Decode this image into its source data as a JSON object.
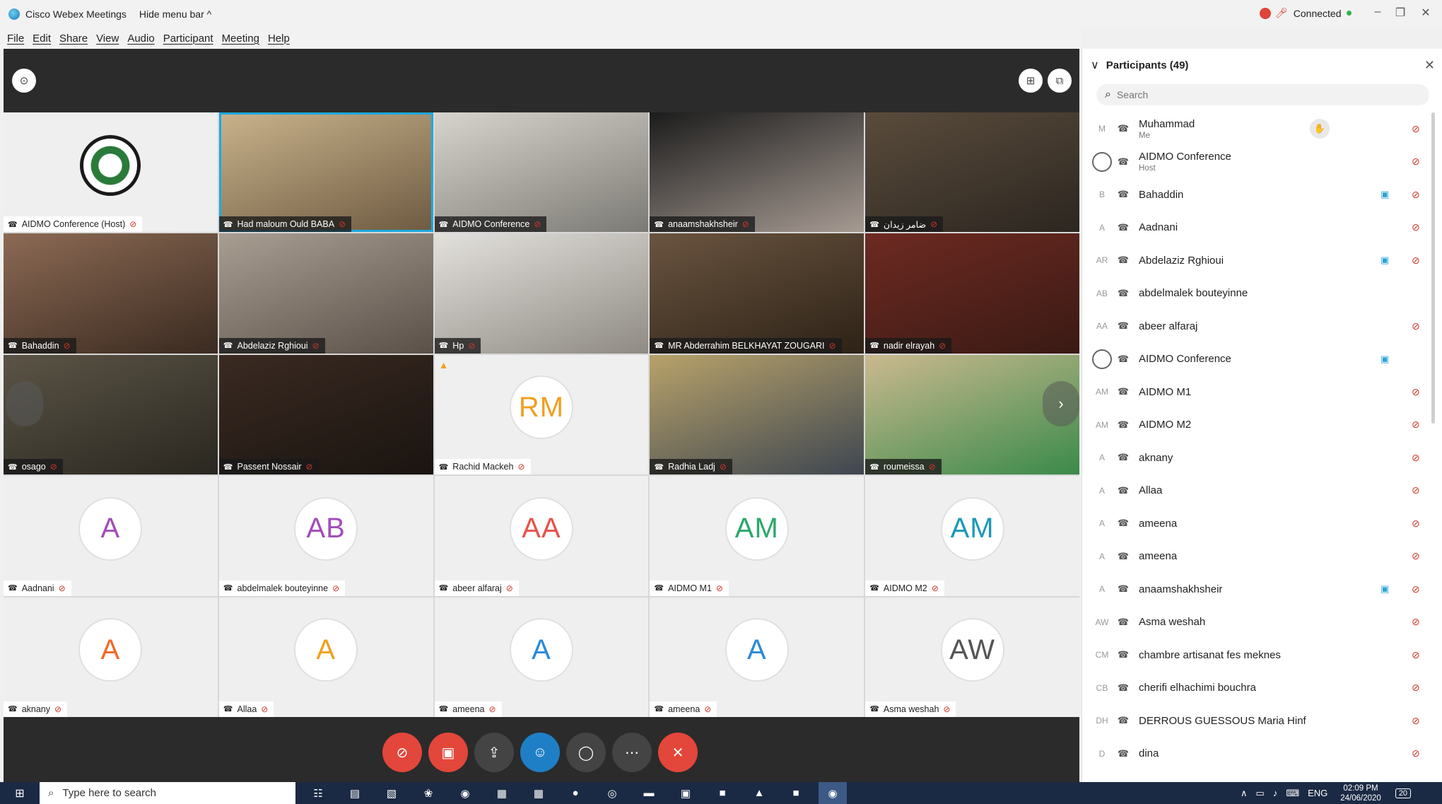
{
  "titlebar": {
    "app_title": "Cisco Webex Meetings",
    "hide_menu": "Hide menu bar ^",
    "status": "Connected",
    "win_min": "–",
    "win_restore": "❐",
    "win_close": "✕"
  },
  "menu": [
    "File",
    "Edit",
    "Share",
    "View",
    "Audio",
    "Participant",
    "Meeting",
    "Help"
  ],
  "tiles": [
    {
      "name": "AIDMO Conference (Host)",
      "type": "logo"
    },
    {
      "name": "Had maloum Ould BABA",
      "type": "video",
      "selected": true
    },
    {
      "name": "AIDMO Conference",
      "type": "video"
    },
    {
      "name": "anaamshakhsheir",
      "type": "video"
    },
    {
      "name": "ضامر زيدان",
      "type": "video"
    },
    {
      "name": "Bahaddin",
      "type": "video"
    },
    {
      "name": "Abdelaziz Rghioui",
      "type": "video"
    },
    {
      "name": "Hp",
      "type": "video"
    },
    {
      "name": "MR Abderrahim BELKHAYAT ZOUGARI",
      "type": "video"
    },
    {
      "name": "nadir elrayah",
      "type": "video"
    },
    {
      "name": "osago",
      "type": "video"
    },
    {
      "name": "Passent Nossair",
      "type": "video"
    },
    {
      "name": "Rachid Mackeh",
      "type": "avatar",
      "initials": "RM",
      "color": "#f0a020"
    },
    {
      "name": "Radhia Ladj",
      "type": "video"
    },
    {
      "name": "roumeissa",
      "type": "video"
    },
    {
      "name": "Aadnani",
      "type": "avatar",
      "initials": "A",
      "color": "#a44cba"
    },
    {
      "name": "abdelmalek bouteyinne",
      "type": "avatar",
      "initials": "AB",
      "color": "#a44cba"
    },
    {
      "name": "abeer alfaraj",
      "type": "avatar",
      "initials": "AA",
      "color": "#e8534a"
    },
    {
      "name": "AIDMO M1",
      "type": "avatar",
      "initials": "AM",
      "color": "#2aa86a"
    },
    {
      "name": "AIDMO M2",
      "type": "avatar",
      "initials": "AM",
      "color": "#1a9ab8"
    },
    {
      "name": "aknany",
      "type": "avatar",
      "initials": "A",
      "color": "#f06a2a"
    },
    {
      "name": "Allaa",
      "type": "avatar",
      "initials": "A",
      "color": "#f0a020"
    },
    {
      "name": "ameena",
      "type": "avatar",
      "initials": "A",
      "color": "#2a8ad8"
    },
    {
      "name": "ameena",
      "type": "avatar",
      "initials": "A",
      "color": "#2a8ad8"
    },
    {
      "name": "Asma weshah",
      "type": "avatar",
      "initials": "AW",
      "color": "#555555"
    }
  ],
  "participants": {
    "title": "Participants (49)",
    "search_placeholder": "Search",
    "items": [
      {
        "name": "Muhammad",
        "sub": "Me",
        "initials": "M"
      },
      {
        "name": "AIDMO Conference",
        "sub": "Host",
        "initials": ""
      },
      {
        "name": "Bahaddin",
        "initials": "B"
      },
      {
        "name": "Aadnani",
        "initials": "A"
      },
      {
        "name": "Abdelaziz Rghioui",
        "initials": "AR"
      },
      {
        "name": "abdelmalek bouteyinne",
        "initials": "AB"
      },
      {
        "name": "abeer alfaraj",
        "initials": "AA"
      },
      {
        "name": "AIDMO Conference",
        "initials": ""
      },
      {
        "name": "AIDMO M1",
        "initials": "AM"
      },
      {
        "name": "AIDMO M2",
        "initials": "AM"
      },
      {
        "name": "aknany",
        "initials": "A"
      },
      {
        "name": "Allaa",
        "initials": "A"
      },
      {
        "name": "ameena",
        "initials": "A"
      },
      {
        "name": "ameena",
        "initials": "A"
      },
      {
        "name": "anaamshakhsheir",
        "initials": "A"
      },
      {
        "name": "Asma weshah",
        "initials": "AW"
      },
      {
        "name": "chambre artisanat fes meknes",
        "initials": "CM"
      },
      {
        "name": "cherifi elhachimi bouchra",
        "initials": "CB"
      },
      {
        "name": "DERROUS GUESSOUS Maria Hinf",
        "initials": "DH"
      },
      {
        "name": "dina",
        "initials": "D"
      }
    ]
  },
  "taskbar": {
    "search_text": "Type here to search",
    "lang": "ENG",
    "time": "02:09 PM",
    "date": "24/06/2020",
    "notif_count": "20"
  }
}
